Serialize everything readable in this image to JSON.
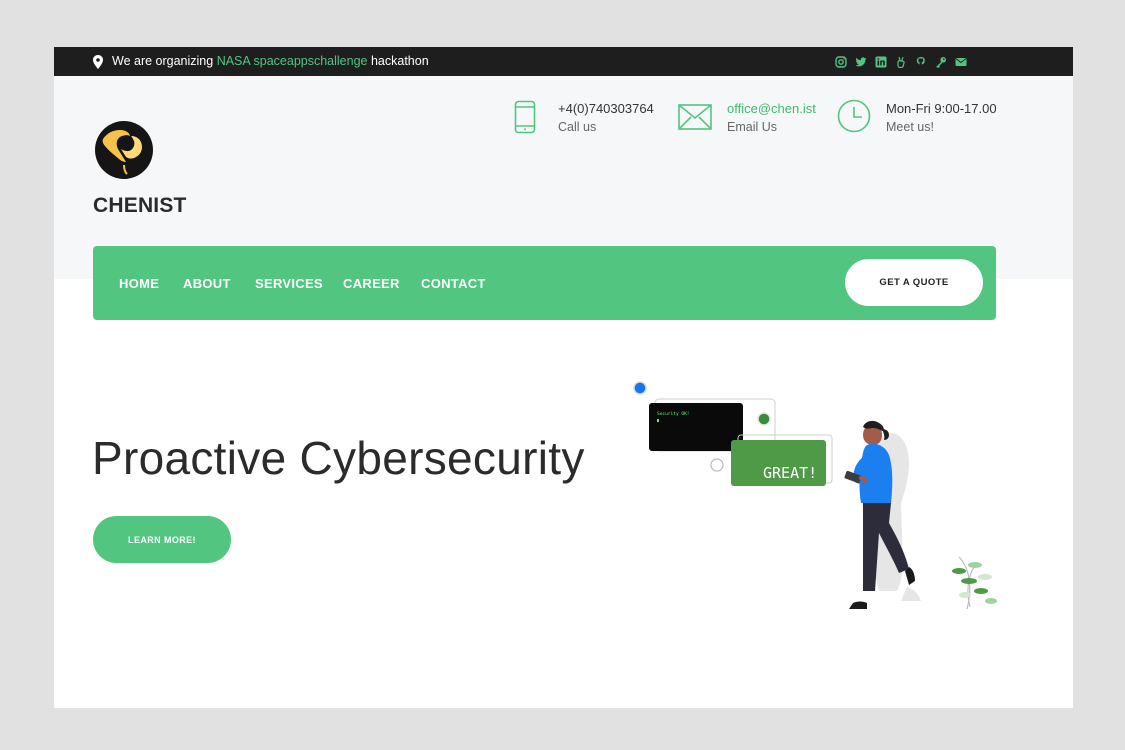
{
  "topbar": {
    "announce_prefix": "We are organizing ",
    "announce_highlight": "NASA spaceappschallenge",
    "announce_suffix": " hackathon",
    "social_icons": [
      "instagram-icon",
      "twitter-icon",
      "linkedin-icon",
      "angellist-icon",
      "github-icon",
      "key-icon",
      "mail-icon"
    ],
    "accent_color": "#52c582"
  },
  "brand": {
    "name": "CHENIST"
  },
  "contacts": [
    {
      "icon": "phone-icon",
      "main": "+4(0)740303764",
      "sub": "Call us"
    },
    {
      "icon": "envelope-icon",
      "main": "office@chen.ist",
      "sub": "Email Us"
    },
    {
      "icon": "clock-icon",
      "main": "Mon-Fri 9:00-17.00",
      "sub": "Meet us!"
    }
  ],
  "nav": {
    "items": [
      "HOME",
      "ABOUT",
      "SERVICES",
      "CAREER",
      "CONTACT"
    ],
    "quote_label": "GET A QUOTE",
    "bg_color": "#52c581"
  },
  "hero": {
    "title": "Proactive Cybersecurity",
    "cta_label": "LEARN MORE!",
    "terminal_text": "Security OK!",
    "badge_text": "GREAT!"
  }
}
